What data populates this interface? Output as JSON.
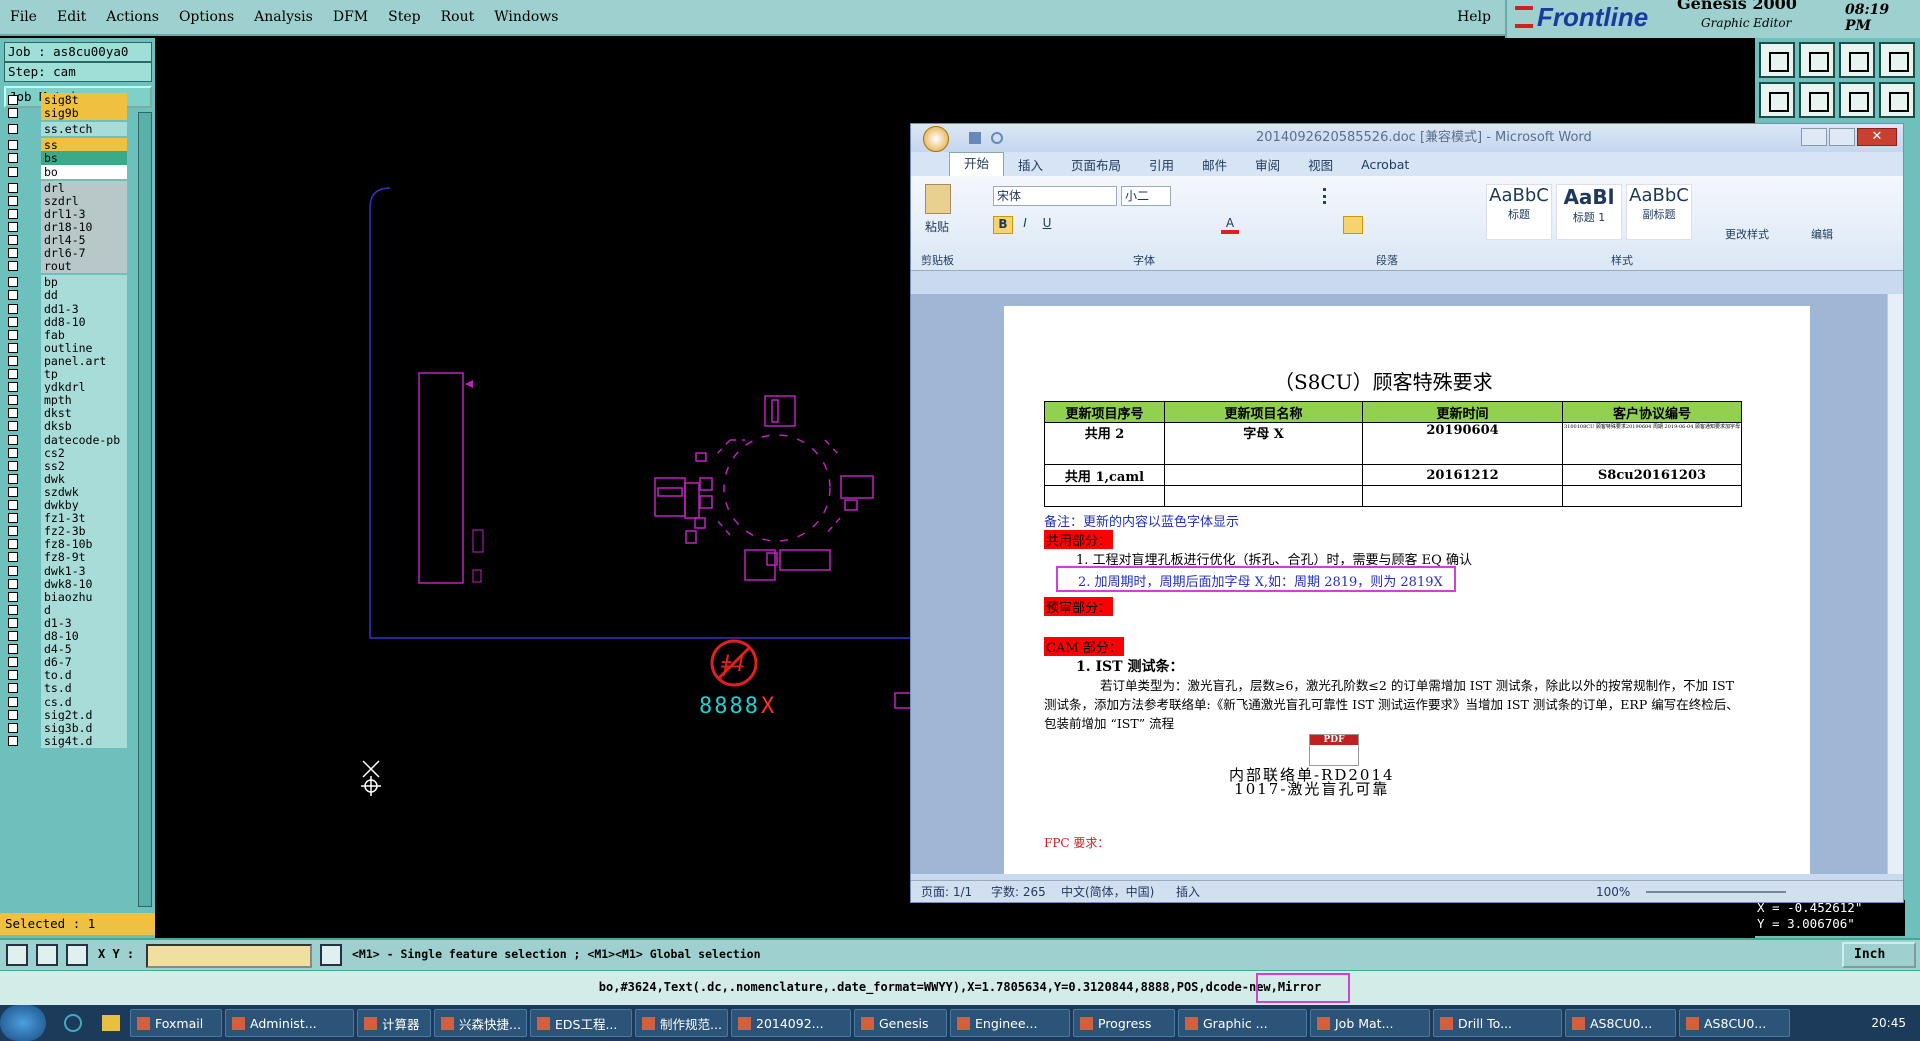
{
  "menubar": {
    "items": [
      "File",
      "Edit",
      "Actions",
      "Options",
      "Analysis",
      "DFM",
      "Step",
      "Rout",
      "Windows"
    ],
    "help": "Help"
  },
  "brand": {
    "logo": "Frontline",
    "product": "Genesis 2000",
    "subtitle": "Graphic Editor",
    "clock": "08:19 PM"
  },
  "job": {
    "job_line": "Job : as8cu00ya0",
    "step_line": "Step: cam",
    "matrix_button": "Job Matrix ..."
  },
  "layers": [
    {
      "name": "sig8t",
      "color": "#f0c040"
    },
    {
      "name": "sig9b",
      "color": "#f0c040"
    },
    {
      "name": "ss.etch",
      "color": "#a8dcd8"
    },
    {
      "name": "ss",
      "color": "#f0c040"
    },
    {
      "name": "bs",
      "color": "#3aaa88"
    },
    {
      "name": "bo",
      "color": "#ffffff"
    },
    {
      "name": "drl",
      "color": "#b8c8c8"
    },
    {
      "name": "szdrl",
      "color": "#b8c8c8"
    },
    {
      "name": "drl1-3",
      "color": "#b8c8c8"
    },
    {
      "name": "dr18-10",
      "color": "#b8c8c8"
    },
    {
      "name": "drl4-5",
      "color": "#b8c8c8"
    },
    {
      "name": "drl6-7",
      "color": "#b8c8c8"
    },
    {
      "name": "rout",
      "color": "#b8c8c8"
    },
    {
      "name": "bp",
      "color": "#a8dcd8"
    },
    {
      "name": "dd",
      "color": "#a8dcd8"
    },
    {
      "name": "dd1-3",
      "color": "#a8dcd8"
    },
    {
      "name": "dd8-10",
      "color": "#a8dcd8"
    },
    {
      "name": "fab",
      "color": "#a8dcd8"
    },
    {
      "name": "outline",
      "color": "#a8dcd8"
    },
    {
      "name": "panel.art",
      "color": "#a8dcd8"
    },
    {
      "name": "tp",
      "color": "#a8dcd8"
    },
    {
      "name": "ydkdrl",
      "color": "#a8dcd8"
    },
    {
      "name": "mpth",
      "color": "#a8dcd8"
    },
    {
      "name": "dkst",
      "color": "#a8dcd8"
    },
    {
      "name": "dksb",
      "color": "#a8dcd8"
    },
    {
      "name": "datecode-pb",
      "color": "#a8dcd8"
    },
    {
      "name": "cs2",
      "color": "#a8dcd8"
    },
    {
      "name": "ss2",
      "color": "#a8dcd8"
    },
    {
      "name": "dwk",
      "color": "#a8dcd8"
    },
    {
      "name": "szdwk",
      "color": "#a8dcd8"
    },
    {
      "name": "dwkby",
      "color": "#a8dcd8"
    },
    {
      "name": "fz1-3t",
      "color": "#a8dcd8"
    },
    {
      "name": "fz2-3b",
      "color": "#a8dcd8"
    },
    {
      "name": "fz8-10b",
      "color": "#a8dcd8"
    },
    {
      "name": "fz8-9t",
      "color": "#a8dcd8"
    },
    {
      "name": "dwk1-3",
      "color": "#a8dcd8"
    },
    {
      "name": "dwk8-10",
      "color": "#a8dcd8"
    },
    {
      "name": "biaozhu",
      "color": "#a8dcd8"
    },
    {
      "name": "d",
      "color": "#a8dcd8"
    },
    {
      "name": "d1-3",
      "color": "#a8dcd8"
    },
    {
      "name": "d8-10",
      "color": "#a8dcd8"
    },
    {
      "name": "d4-5",
      "color": "#a8dcd8"
    },
    {
      "name": "d6-7",
      "color": "#a8dcd8"
    },
    {
      "name": "to.d",
      "color": "#a8dcd8"
    },
    {
      "name": "ts.d",
      "color": "#a8dcd8"
    },
    {
      "name": "cs.d",
      "color": "#a8dcd8"
    },
    {
      "name": "sig2t.d",
      "color": "#a8dcd8"
    },
    {
      "name": "sig3b.d",
      "color": "#a8dcd8"
    },
    {
      "name": "sig4t.d",
      "color": "#a8dcd8"
    }
  ],
  "selected": "Selected : 1",
  "canvas": {
    "datecode": "8888",
    "datecode_suffix": "X",
    "symbol_text": "ǂ4"
  },
  "coords": {
    "x": "X = -0.452612\"",
    "y": "Y = 3.006706\""
  },
  "cmdbar": {
    "xy_label": "X Y :",
    "hint": "<M1> - Single feature selection ; <M1><M1> Global selection",
    "units": "Inch"
  },
  "status": {
    "line": "bo,#3624,Text(.dc,.nomenclature,.date_format=WWYY),X=1.7805634,Y=0.3120844,8888,POS,dcode-new,Mirror"
  },
  "word": {
    "title": "2014092620585526.doc [兼容模式] - Microsoft Word",
    "tabs": [
      "开始",
      "插入",
      "页面布局",
      "引用",
      "邮件",
      "审阅",
      "视图",
      "Acrobat"
    ],
    "ribbon": {
      "font_name": "宋体",
      "font_size": "小二",
      "groups": [
        "剪贴板",
        "字体",
        "段落",
        "样式"
      ],
      "paste": "粘贴",
      "styles": [
        {
          "sample": "AaBbC",
          "name": "标题"
        },
        {
          "sample": "AaBl",
          "name": "标题 1"
        },
        {
          "sample": "AaBbC",
          "name": "副标题"
        }
      ],
      "change_styles": "更改样式",
      "edit": "编辑"
    },
    "doc": {
      "heading": "（S8CU）顾客特殊要求",
      "table_headers": [
        "更新项目序号",
        "更新项目名称",
        "更新时间",
        "客户协议编号"
      ],
      "table_rows": [
        [
          "共用 2",
          "字母 X",
          "20190604",
          "3100108CU 顾客特殊要求20190604 周期 2019-06-04 顾客通知要求加字母"
        ],
        [
          "共用 1,caml",
          "",
          "20161212",
          "S8cu20161203"
        ],
        [
          "",
          "",
          "",
          ""
        ]
      ],
      "note": "备注：更新的内容以蓝色字体显示",
      "sec_common": "共用部分：",
      "item1": "1. 工程对盲埋孔板进行优化（拆孔、合孔）时，需要与顾客 EQ 确认",
      "item2": "2. 加周期时，周期后面加字母 X,如：周期 2819，则为 2819X",
      "sec_pre": "预审部分：",
      "sec_cam": "CAM 部分：",
      "ist_title": "1. IST 测试条：",
      "ist_body": "若订单类型为：激光盲孔，层数≥6，激光孔阶数≤2 的订单需增加 IST 测试条，除此以外的按常规制作，不加 IST 测试条，添加方法参考联络单:《新飞通激光盲孔可靠性 IST 测试运作要求》当增加 IST 测试条的订单，ERP 编写在终检后、包装前增加 “IST” 流程",
      "attach_label": "PDF",
      "attach_line1": "内部联络单-RD2014",
      "attach_line2": "1017-激光盲孔可靠",
      "fpc": "FPC 要求："
    },
    "status": {
      "page": "页面: 1/1",
      "words": "字数: 265",
      "lang": "中文(简体，中国)",
      "insert": "插入",
      "zoom": "100%"
    }
  },
  "taskbar": {
    "items": [
      "Foxmail",
      "Administ...",
      "计算器",
      "兴森快捷...",
      "EDS工程...",
      "制作规范...",
      "2014092...",
      "Genesis",
      "Enginee...",
      "Progress",
      "Graphic ...",
      "Job Mat...",
      "Drill To...",
      "AS8CU0...",
      "AS8CU0..."
    ],
    "clock": "20:45"
  }
}
